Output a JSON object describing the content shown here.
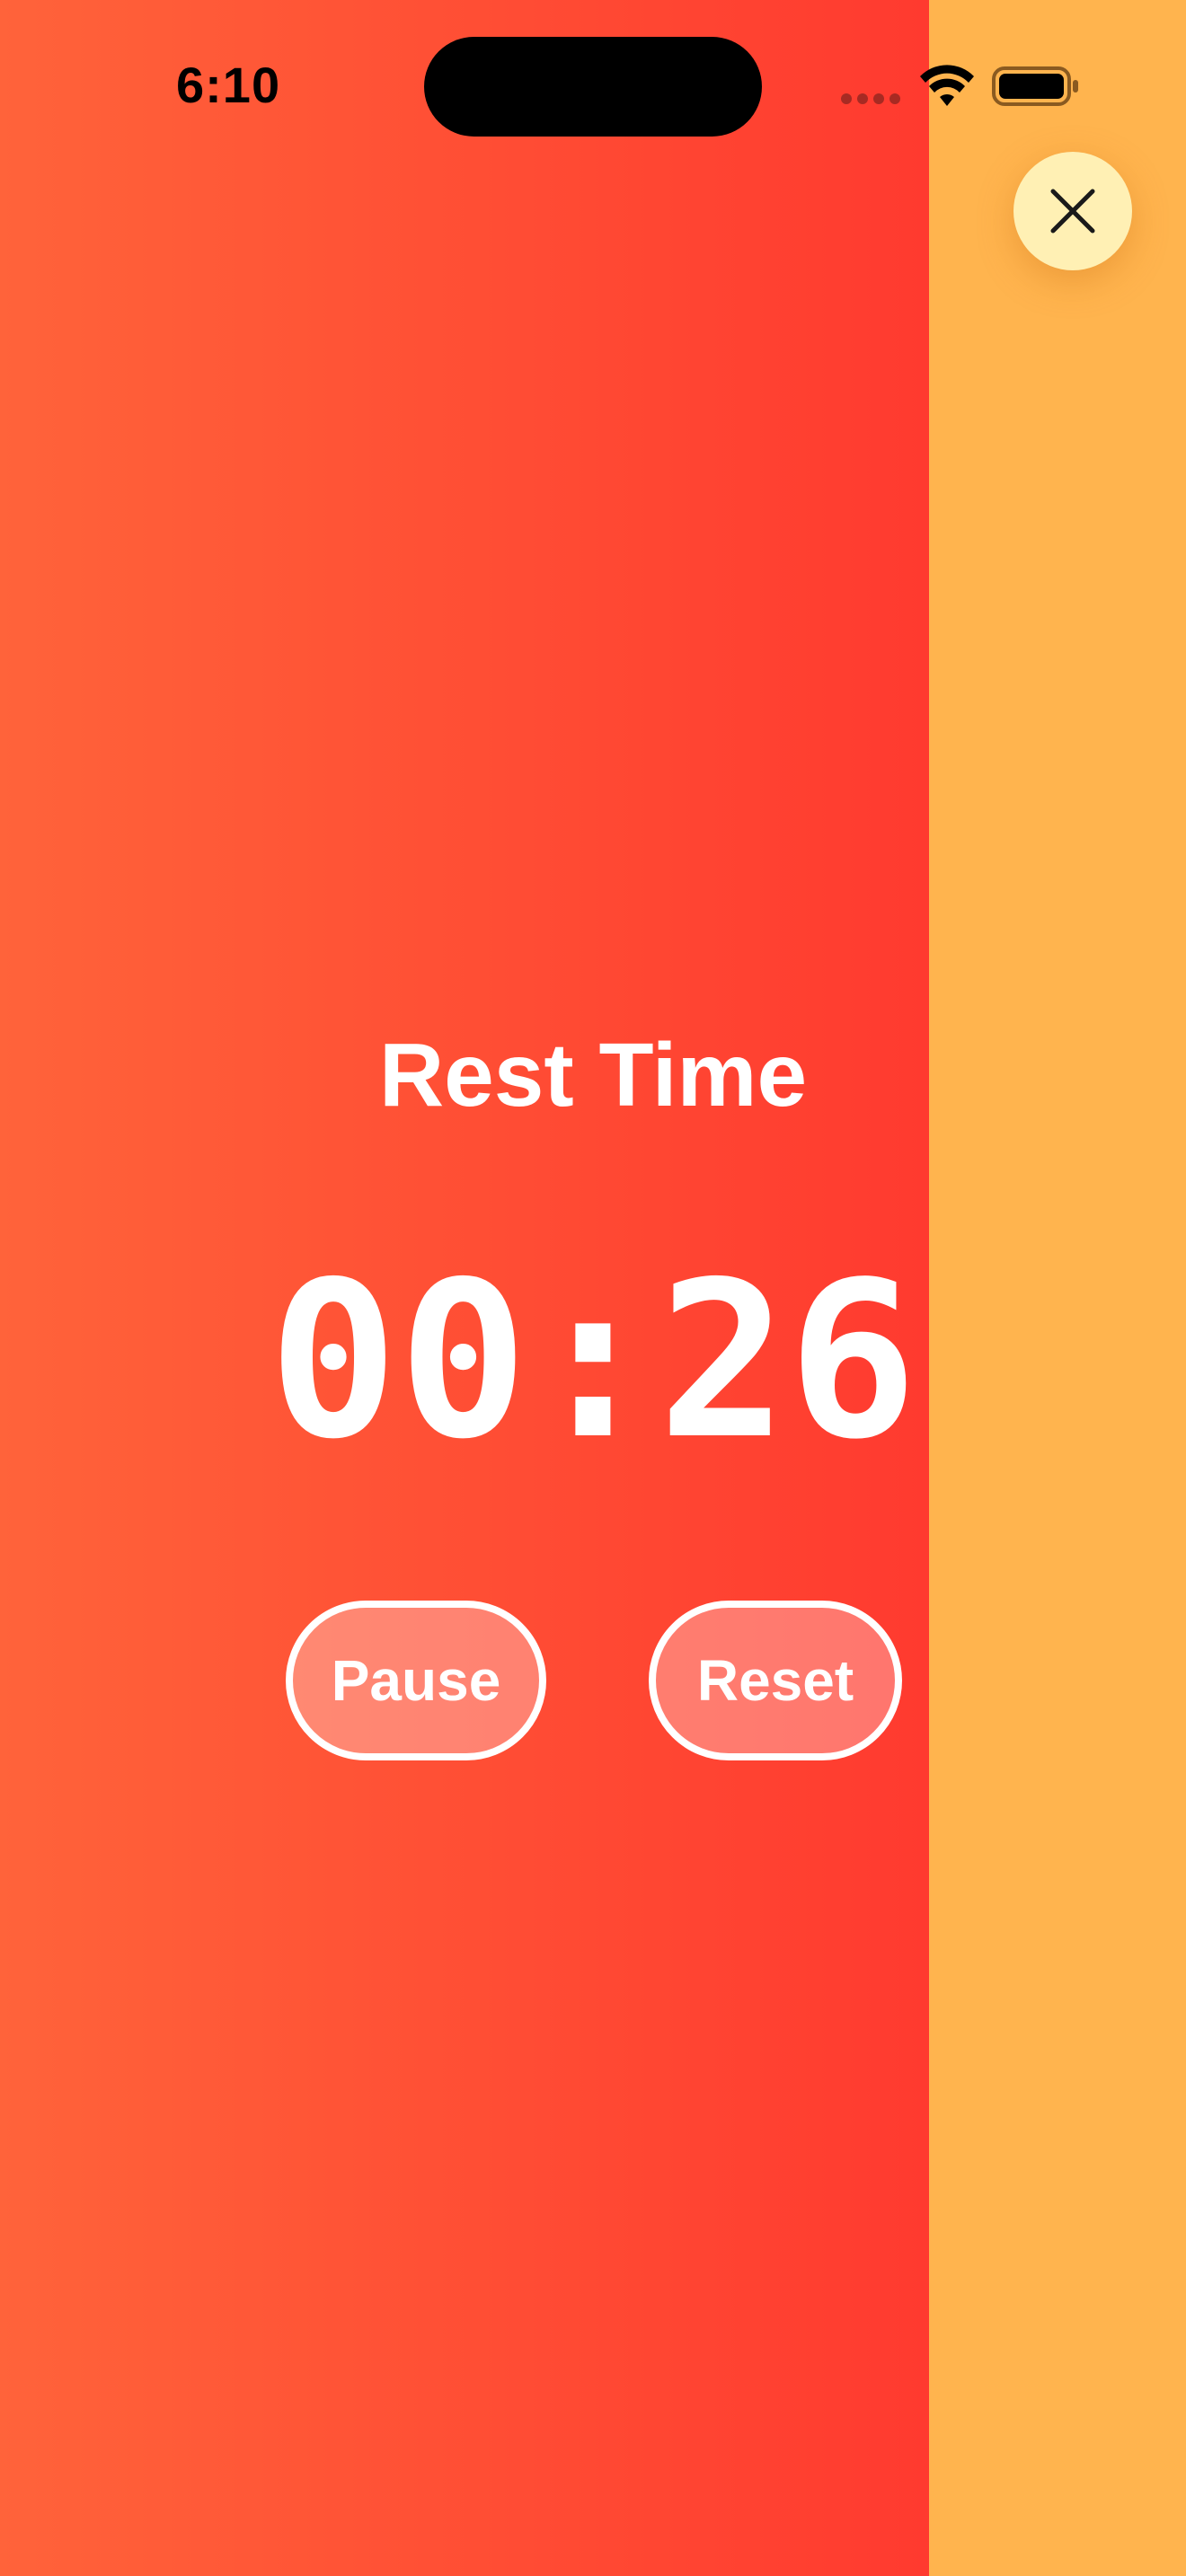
{
  "status_bar": {
    "time": "6:10",
    "icons": [
      "signal-dots-icon",
      "wifi-icon",
      "battery-icon"
    ]
  },
  "close_button": {
    "icon": "close-icon"
  },
  "timer": {
    "title": "Rest Time",
    "display": "00:26"
  },
  "controls": {
    "pause_label": "Pause",
    "reset_label": "Reset"
  },
  "colors": {
    "gradient_start": "#FF633A",
    "gradient_end": "#FF3A2F",
    "side_panel": "#FFB44E",
    "close_button_bg": "#FFF0B4",
    "text": "#FFFFFF"
  }
}
